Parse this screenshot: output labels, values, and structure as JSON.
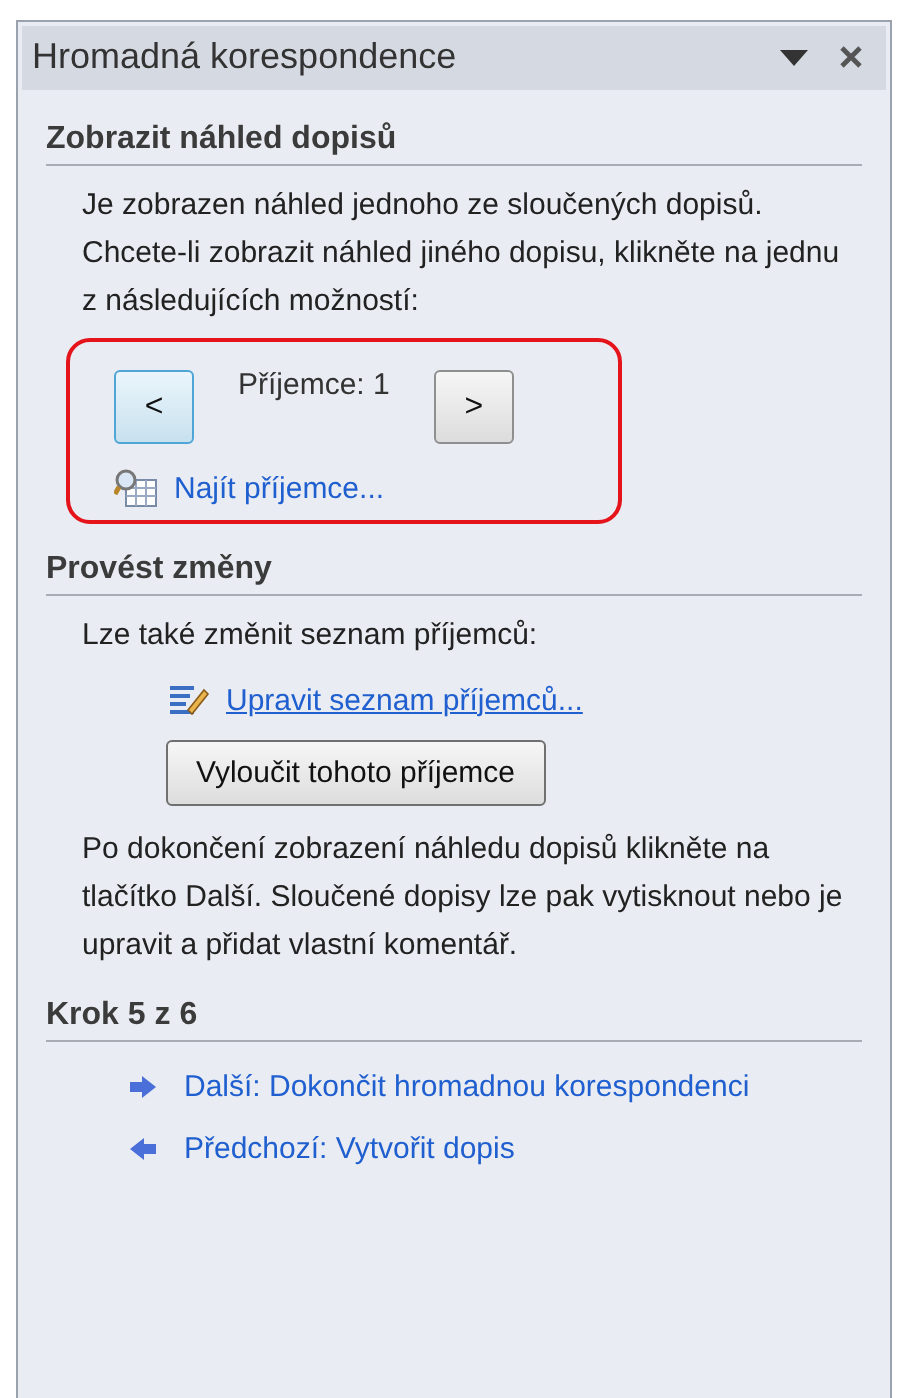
{
  "window": {
    "title": "Hromadná korespondence"
  },
  "preview": {
    "heading": "Zobrazit náhled dopisů",
    "text": "Je zobrazen náhled jednoho ze sloučených dopisů. Chcete-li zobrazit náhled jiného dopisu, klikněte na jednu z následujících možností:",
    "prev_button": "<",
    "recipient": "Příjemce: 1",
    "next_button": ">",
    "find_link": "Najít příjemce...",
    "highlighted": true
  },
  "changes": {
    "heading": "Provést změny",
    "text": "Lze také změnit seznam příjemců:",
    "edit_link": "Upravit seznam příjemců...",
    "exclude_button": "Vyloučit tohoto příjemce",
    "note": "Po dokončení zobrazení náhledu dopisů klikněte na tlačítko Další. Sloučené dopisy lze pak vytisknout nebo je upravit a přidat vlastní komentář."
  },
  "step": {
    "heading": "Krok 5 z 6",
    "links": [
      {
        "kind": "next",
        "label": "Další: Dokončit hromadnou korespondenci"
      },
      {
        "kind": "previous",
        "label": "Předchozí: Vytvořit dopis"
      }
    ]
  }
}
